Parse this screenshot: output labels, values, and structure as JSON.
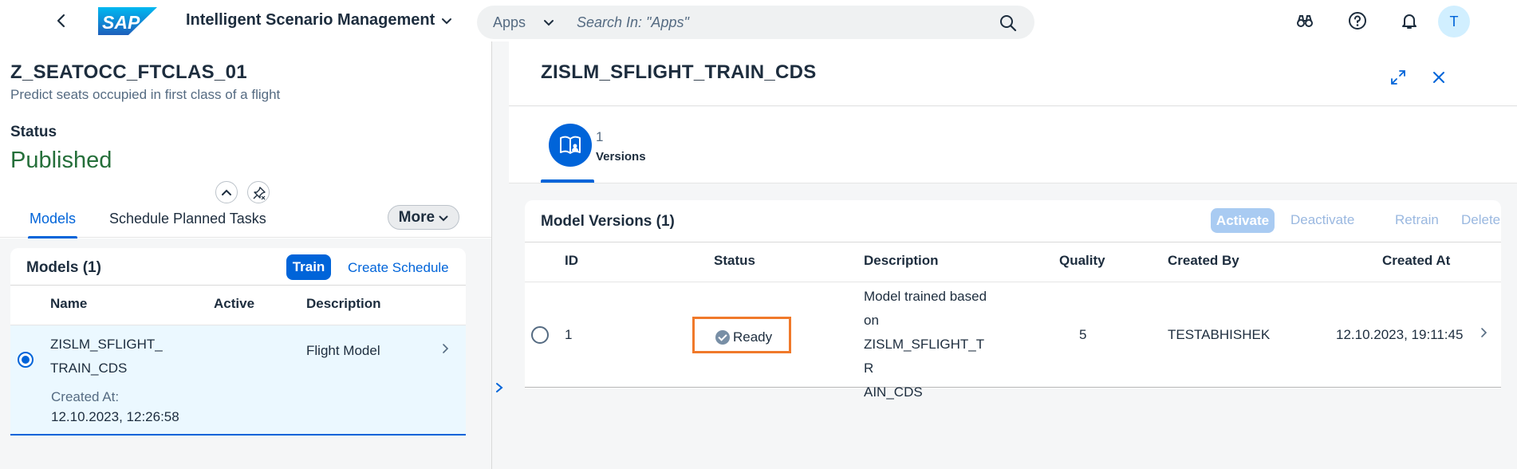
{
  "shell": {
    "app_title": "Intelligent Scenario Management",
    "logo_text": "SAP",
    "search_scope": "Apps",
    "search_placeholder": "Search In: \"Apps\"",
    "avatar_initial": "T"
  },
  "object": {
    "title": "Z_SEATOCC_FTCLAS_01",
    "subtitle": "Predict seats occupied in first class of a flight",
    "status_label": "Status",
    "status_value": "Published",
    "status_color": "#256f3a"
  },
  "tabs": {
    "items": [
      "Models",
      "Schedule Planned Tasks"
    ],
    "active": "Models",
    "more_label": "More"
  },
  "models": {
    "title": "Models (1)",
    "train_label": "Train",
    "create_schedule_label": "Create Schedule",
    "columns": [
      "Name",
      "Active",
      "Description"
    ],
    "rows": [
      {
        "name_line1": "ZISLM_SFLIGHT_",
        "name_line2": "TRAIN_CDS",
        "description": "Flight Model",
        "created_label": "Created At:",
        "created_value": "12.10.2023, 12:26:58"
      }
    ]
  },
  "detail": {
    "title": "ZISLM_SFLIGHT_TRAIN_CDS",
    "icon_tab_count": "1",
    "icon_tab_label": "Versions",
    "versions_title": "Model Versions (1)",
    "actions": {
      "activate": "Activate",
      "deactivate": "Deactivate",
      "retrain": "Retrain",
      "delete": "Delete"
    },
    "columns": {
      "id": "ID",
      "status": "Status",
      "description": "Description",
      "quality": "Quality",
      "created_by": "Created By",
      "created_at": "Created At"
    },
    "rows": [
      {
        "id": "1",
        "status": "Ready",
        "description_lines": [
          "Model trained based",
          "on",
          "ZISLM_SFLIGHT_TR",
          "AIN_CDS"
        ],
        "quality": "5",
        "created_by": "TESTABHISHEK",
        "created_at": "12.10.2023, 19:11:45"
      }
    ]
  },
  "colors": {
    "accent": "#0064d9",
    "highlight_box": "#f0792a",
    "selected_row_bg": "#ebf8ff"
  }
}
